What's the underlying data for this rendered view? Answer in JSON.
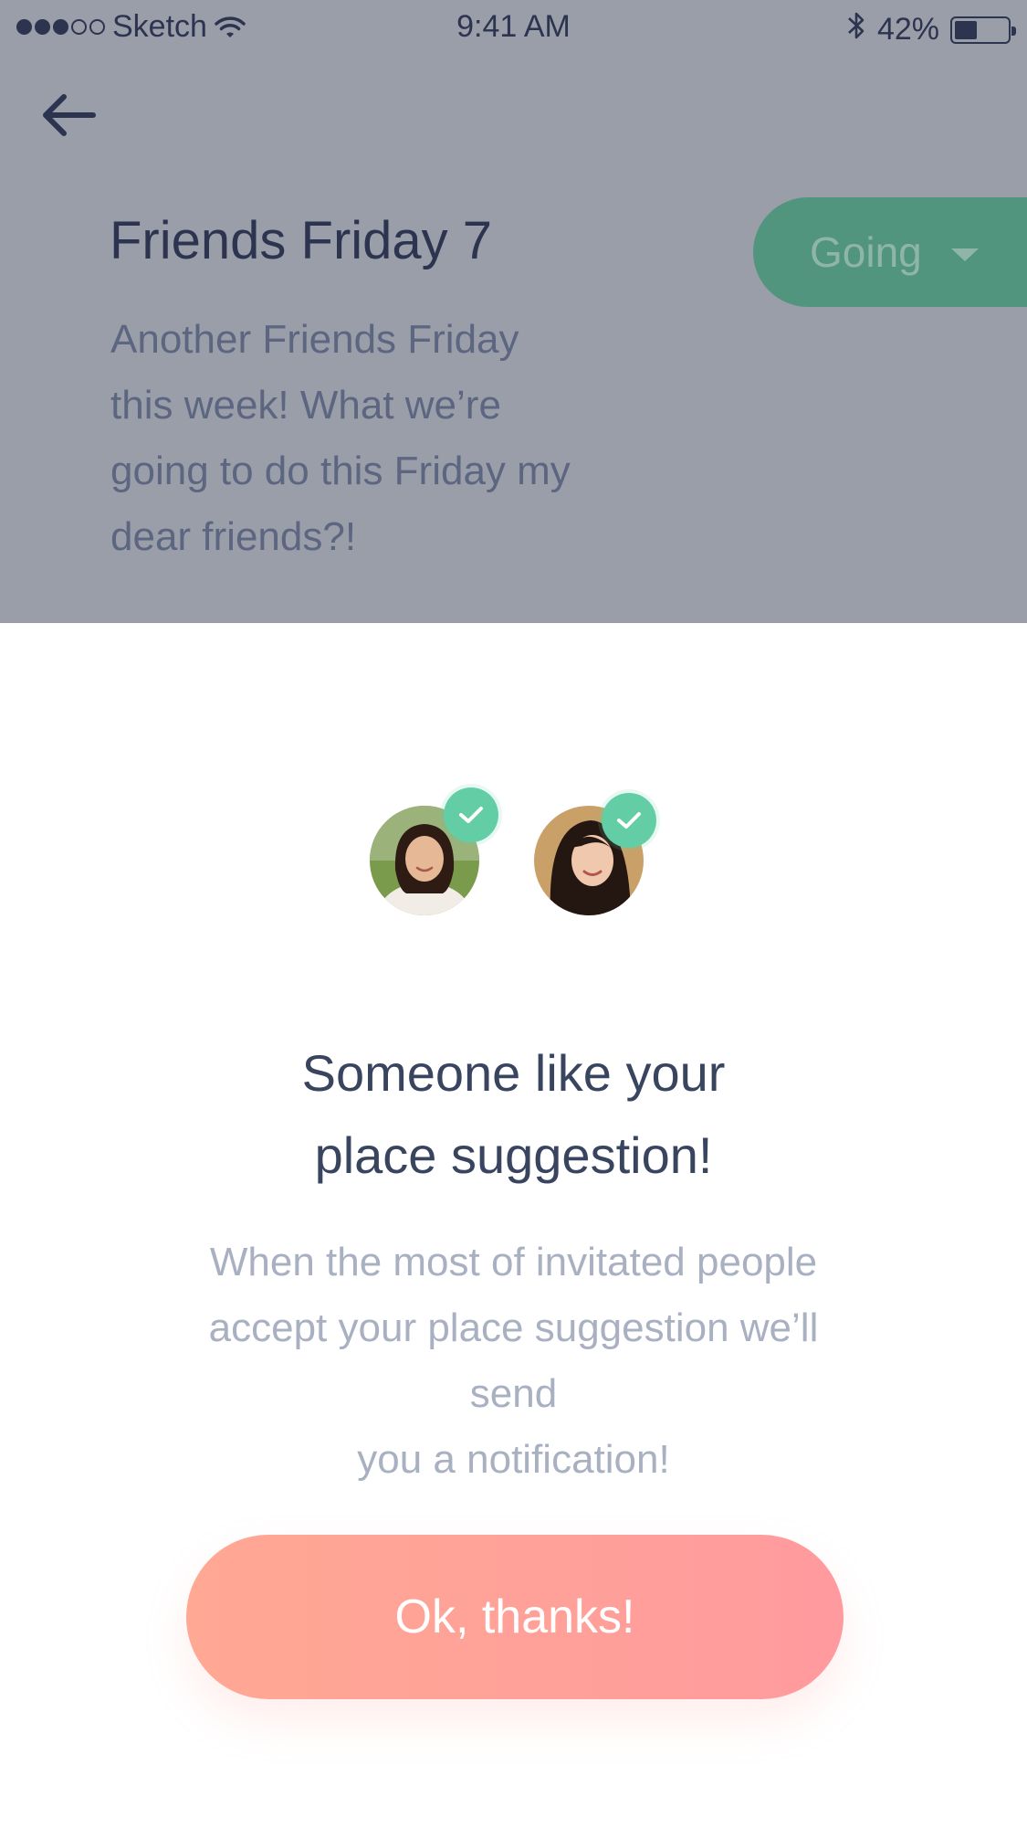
{
  "status_bar": {
    "carrier": "Sketch",
    "time": "9:41 AM",
    "battery": "42%",
    "battery_level": 0.42,
    "signal_bars_filled": 3,
    "signal_bars_total": 5
  },
  "header": {
    "back_icon": "arrow-left-icon"
  },
  "event": {
    "title": "Friends Friday 7",
    "description": "Another Friends Friday this week! What we’re going to do this Friday my dear friends?!",
    "rsvp_label": "Going",
    "rsvp_color": "#52957f"
  },
  "modal": {
    "avatars": [
      {
        "name": "avatar-1",
        "checked": true
      },
      {
        "name": "avatar-2",
        "checked": true
      }
    ],
    "title_line1": "Someone like your",
    "title_line2": "place suggestion!",
    "body_line1": "When the most of invitated people",
    "body_line2": "accept your place suggestion we’ll",
    "body_line3": "send",
    "body_line4": "you a notification!",
    "button_label": "Ok, thanks!",
    "accent_color": "#63cea5",
    "button_gradient": [
      "#ffa893",
      "#ff9a9e"
    ]
  }
}
